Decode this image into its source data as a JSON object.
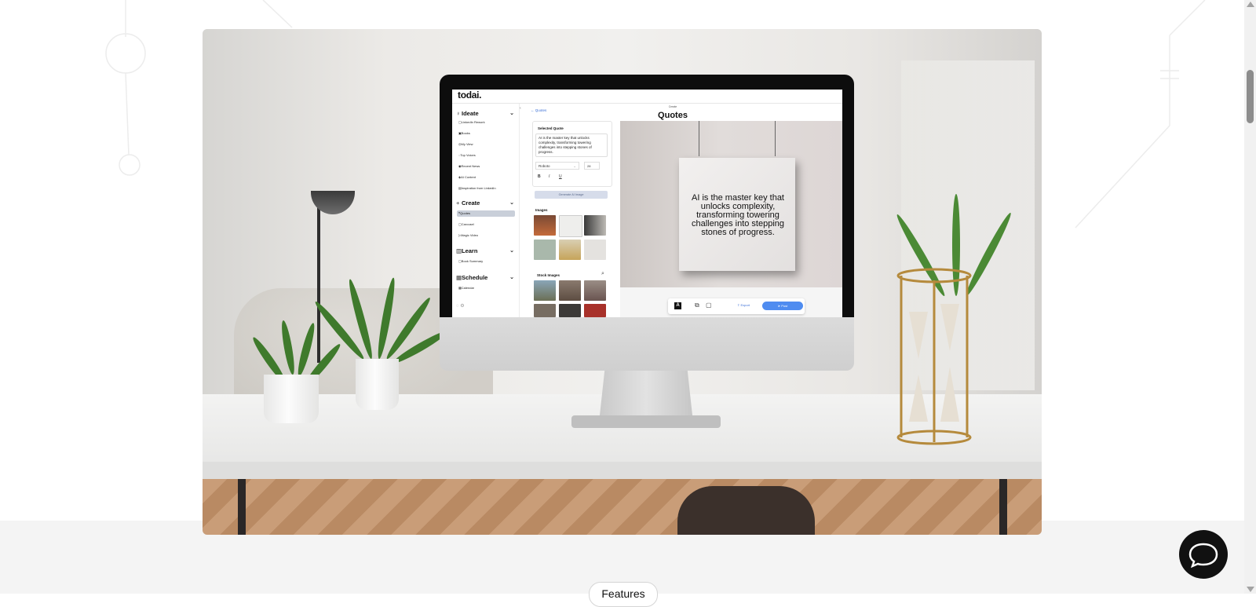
{
  "app": {
    "logo": "todai.",
    "sidebar": {
      "sections": [
        {
          "label": "Ideate",
          "icon": "lightbulb-icon",
          "items": [
            "LinkedIn Rework",
            "Books",
            "My View",
            "Top Voices",
            "Recent News",
            "AI Content",
            "Inspiration from LinkedIn"
          ]
        },
        {
          "label": "Create",
          "icon": "plus-icon",
          "items": [
            "Quotes",
            "Carousel",
            "Magic Video"
          ],
          "active_item": "Quotes"
        },
        {
          "label": "Learn",
          "icon": "book-icon",
          "items": [
            "Book Summary"
          ]
        },
        {
          "label": "Schedule",
          "icon": "calendar-icon",
          "items": [
            "Calendar"
          ]
        }
      ]
    },
    "back_link": "← Quotes",
    "breadcrumb": "Create",
    "page_title": "Quotes",
    "editor": {
      "selected_quote_title": "Selected Quote",
      "quote_text": "AI is the master key that unlocks complexity, transforming towering challenges into stepping stones of progress.",
      "font": "Roboto",
      "font_size": "28",
      "format_bold": "B",
      "format_italic": "I",
      "format_underline": "U",
      "generate_button": "Generate AI Image",
      "images_title": "Images",
      "stock_images_title": "Stock Images"
    },
    "canvas": {
      "poster_text": "AI is the master key that unlocks complexity, transforming towering challenges into stepping stones of progress.",
      "text_tool": "A",
      "export_label": "Export",
      "post_label": "Post"
    }
  },
  "section_pill": "Features",
  "colors": {
    "accent_blue": "#4f8cf0",
    "active_item_bg": "#c9cfd9",
    "chat_button": "#111111"
  }
}
